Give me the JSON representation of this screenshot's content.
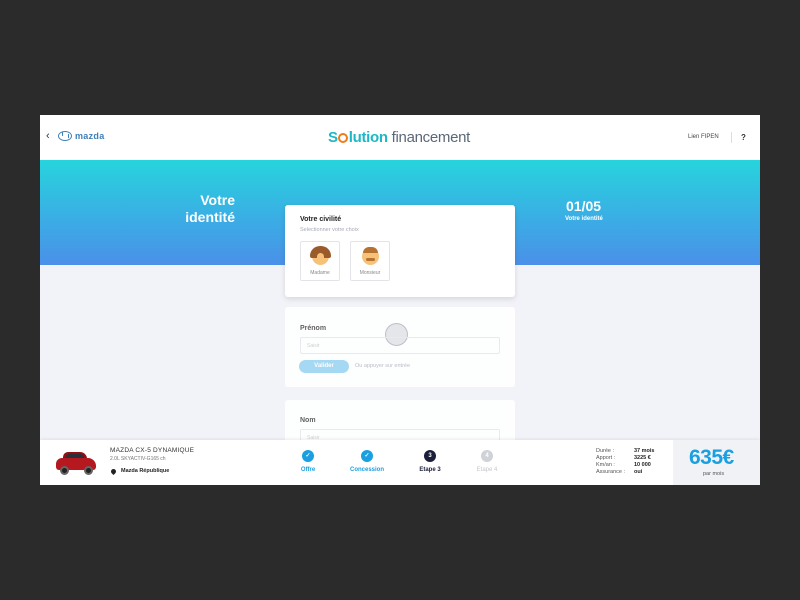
{
  "header": {
    "back_icon": "‹",
    "logo_text": "mazda",
    "brand_prefix": "S",
    "brand_suffix": "lution",
    "brand_second": "financement",
    "link_label": "Lien FIPEN",
    "help_label": "?"
  },
  "banner": {
    "title": "Votre identité",
    "step_counter": "01/05",
    "step_label": "Votre identité"
  },
  "civilite": {
    "title": "Votre civilité",
    "subtitle": "Selectionner votre choix",
    "options": [
      {
        "label": "Madame",
        "icon": "woman-face-icon"
      },
      {
        "label": "Monsieur",
        "icon": "man-face-icon"
      }
    ]
  },
  "prenom": {
    "label": "Prénom",
    "placeholder": "Saisir",
    "validate_label": "Valider",
    "hint": "Ou appuyer sur entrée"
  },
  "nom": {
    "label": "Nom",
    "placeholder": "Saisir"
  },
  "footer": {
    "car_name": "MAZDA CX-5 DYNAMIQUE",
    "car_spec": "2.0L SKYACTIV-G165 ch",
    "dealer": "Mazda République",
    "steps": [
      {
        "label": "Offre",
        "state": "done",
        "marker": "✓"
      },
      {
        "label": "Concession",
        "state": "done",
        "marker": "✓"
      },
      {
        "label": "Etape 3",
        "state": "current",
        "marker": "3"
      },
      {
        "label": "Etape 4",
        "state": "todo",
        "marker": "4"
      }
    ],
    "summary": [
      {
        "key": "Durée :",
        "value": "37 mois"
      },
      {
        "key": "Apport :",
        "value": "3225 €"
      },
      {
        "key": "Km/an :",
        "value": "10 000"
      },
      {
        "key": "Assurance :",
        "value": "oui"
      }
    ],
    "price": "635€",
    "price_unit": "par mois"
  },
  "colors": {
    "accent": "#1a9fe0",
    "banner_top": "#27d4dc",
    "banner_bottom": "#4a90e8",
    "brand_teal": "#1cb8c6",
    "brand_orange": "#f27b1a"
  }
}
